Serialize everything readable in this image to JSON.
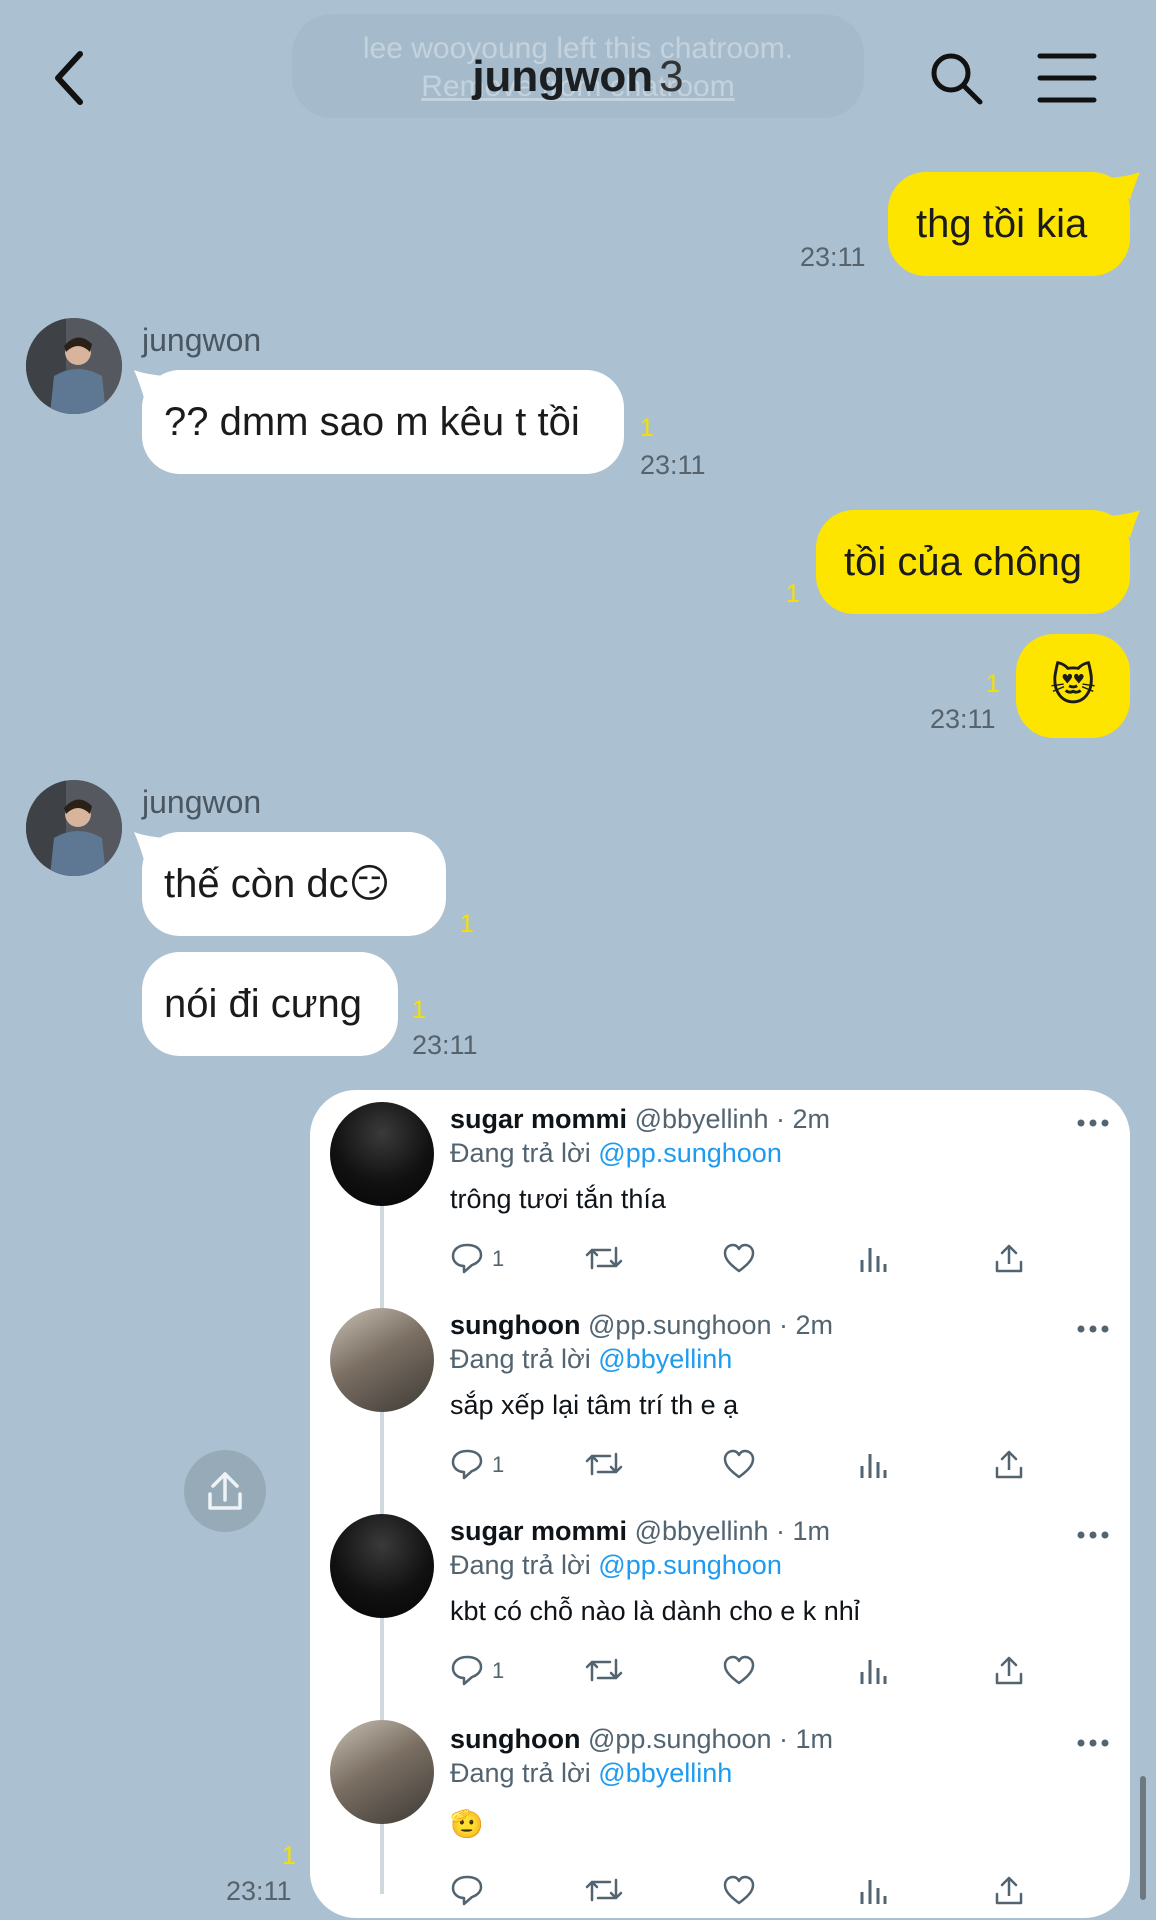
{
  "header": {
    "system_message": "lee wooyoung left this chatroom.",
    "system_link": "Remove from chatroom",
    "title": "jungwon",
    "member_count": "3"
  },
  "messages": {
    "m1": {
      "text": "thg tồi kia",
      "time": "23:11"
    },
    "m2": {
      "sender": "jungwon",
      "text": "?? dmm sao m kêu t tồi",
      "unread": "1",
      "time": "23:11"
    },
    "m3": {
      "text": "tồi của chông",
      "unread": "1"
    },
    "m4": {
      "emoji": "😻",
      "unread": "1",
      "time": "23:11"
    },
    "m5": {
      "sender": "jungwon",
      "text": "thế còn dc😏",
      "unread": "1"
    },
    "m6": {
      "text": "nói đi cưng",
      "unread": "1",
      "time": "23:11"
    },
    "m7": {
      "unread": "1",
      "time": "23:11"
    }
  },
  "tweets": [
    {
      "name": "sugar mommi",
      "meta": "@bbyellinh · 2m",
      "reply_prefix": "Đang trả lời",
      "reply_to": "@pp.sunghoon",
      "text": "trông tươi tắn thía",
      "reply_count": "1"
    },
    {
      "name": "sunghoon",
      "meta": "@pp.sunghoon · 2m",
      "reply_prefix": "Đang trả lời",
      "reply_to": "@bbyellinh",
      "text": "sắp xếp lại tâm trí th e ạ",
      "reply_count": "1"
    },
    {
      "name": "sugar mommi",
      "meta": "@bbyellinh · 1m",
      "reply_prefix": "Đang trả lời",
      "reply_to": "@pp.sunghoon",
      "text": "kbt có chỗ nào là dành cho e k nhỉ",
      "reply_count": "1"
    },
    {
      "name": "sunghoon",
      "meta": "@pp.sunghoon · 1m",
      "reply_prefix": "Đang trả lời",
      "reply_to": "@bbyellinh",
      "text": "🫡",
      "reply_count": ""
    }
  ],
  "colors": {
    "background": "#abc1d1",
    "my_bubble": "#fee500",
    "their_bubble": "#ffffff",
    "unread_badge": "#f6e000",
    "link_blue": "#1d9bf0"
  },
  "icons": [
    "back-chevron-icon",
    "search-icon",
    "menu-icon",
    "share-icon",
    "more-icon",
    "reply-icon",
    "retweet-icon",
    "like-icon",
    "views-icon",
    "share-tweet-icon"
  ]
}
